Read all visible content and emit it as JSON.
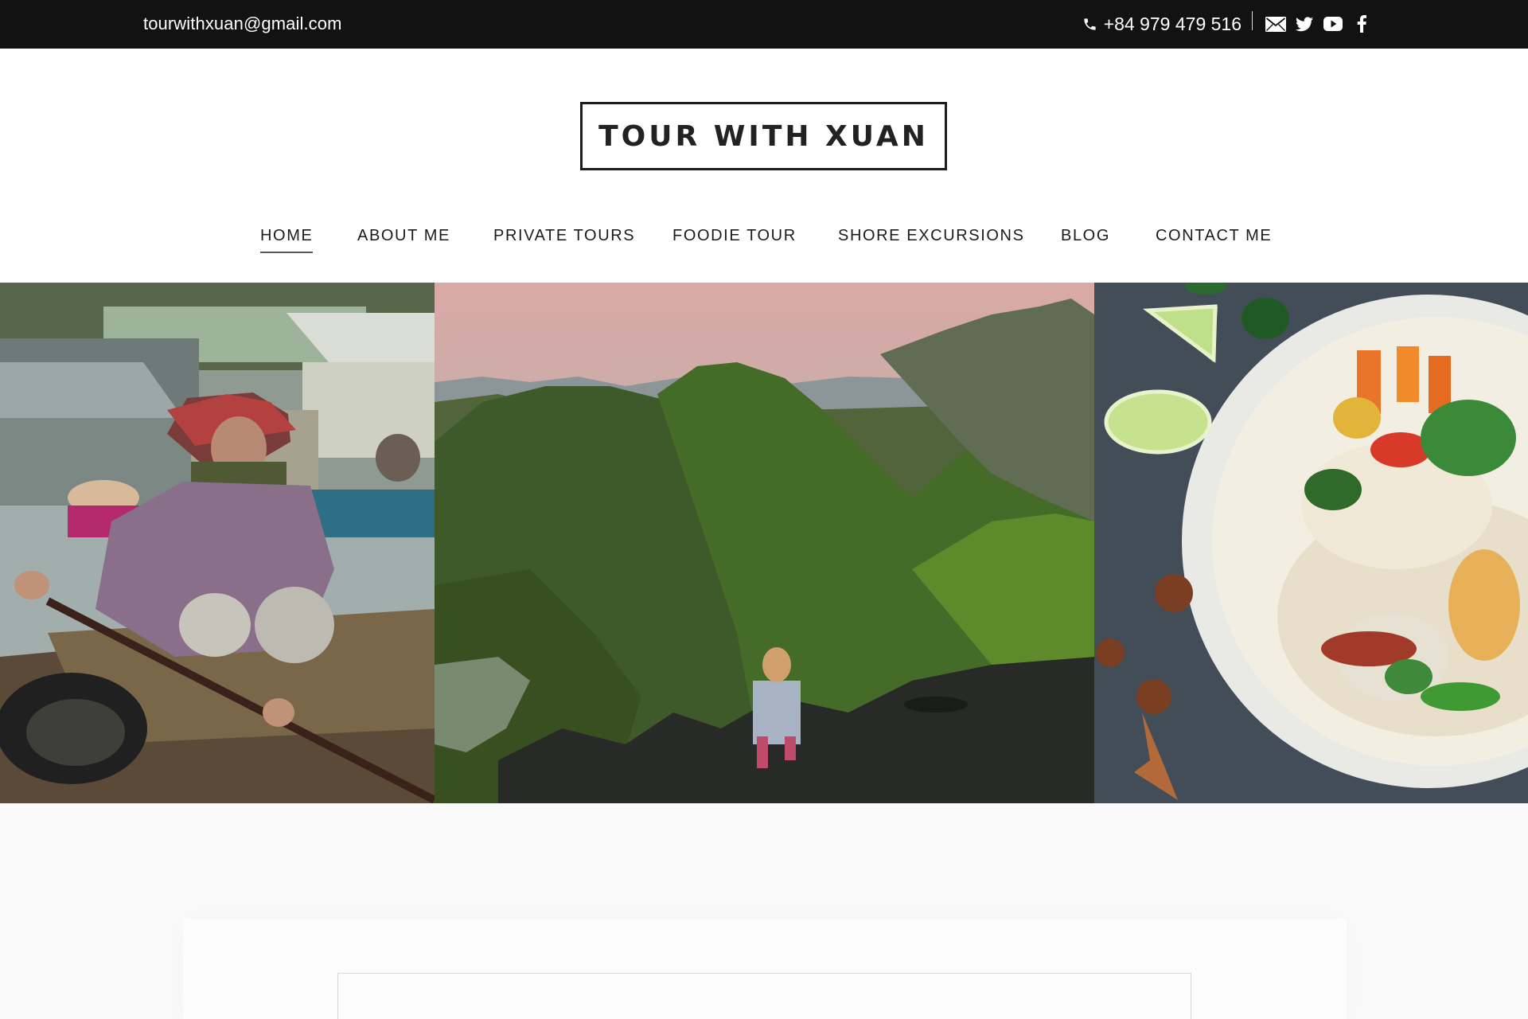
{
  "topbar": {
    "email": "tourwithxuan@gmail.com",
    "phone": "+84 979 479 516",
    "icons": [
      "phone-icon",
      "mail-icon",
      "twitter-icon",
      "youtube-icon",
      "facebook-icon"
    ]
  },
  "brand": {
    "logo_text": "TOUR WITH XUAN"
  },
  "nav": {
    "items": [
      {
        "label": "HOME",
        "active": true
      },
      {
        "label": "ABOUT ME",
        "active": false
      },
      {
        "label": "PRIVATE TOURS",
        "active": false
      },
      {
        "label": "FOODIE TOUR",
        "active": false
      },
      {
        "label": "SHORE EXCURSIONS",
        "active": false
      },
      {
        "label": "BLOG",
        "active": false
      },
      {
        "label": "CONTACT ME",
        "active": false
      }
    ]
  },
  "hero": {
    "images": [
      "woman-rowing-boat-photo",
      "karst-mountains-photo",
      "noodle-soup-photo"
    ]
  },
  "colors": {
    "topbar_bg": "#121212",
    "text": "#1a1a1a",
    "page_bg": "#ffffff"
  }
}
